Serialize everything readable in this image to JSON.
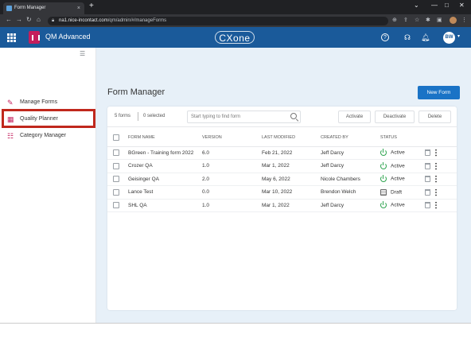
{
  "browser": {
    "tab_title": "Form Manager",
    "tab_close": "×",
    "new_tab": "+",
    "url_domain": "na1.nice-incontact.com",
    "url_path": "/qm/admin/#/manageForms",
    "window_controls": [
      "⌄",
      "—",
      "□",
      "✕"
    ]
  },
  "app": {
    "title": "QM Advanced",
    "logo_text": "CXone",
    "avatar_initials": "BW"
  },
  "sidebar": {
    "items": [
      {
        "label": "Manage Forms",
        "icon": "edit-form-icon"
      },
      {
        "label": "Quality Planner",
        "icon": "calendar-icon"
      },
      {
        "label": "Category Manager",
        "icon": "list-icon"
      }
    ]
  },
  "page": {
    "title": "Form Manager",
    "new_form_label": "New Form"
  },
  "toolbar": {
    "forms_count": "5 forms",
    "selected_count": "0 selected",
    "search_placeholder": "Start typing to find form",
    "activate_label": "Activate",
    "deactivate_label": "Deactivate",
    "delete_label": "Delete"
  },
  "table": {
    "headers": [
      "FORM NAME",
      "VERSION",
      "LAST MODIFIED",
      "CREATED BY",
      "STATUS"
    ],
    "rows": [
      {
        "name": "BGreen - Training form 2022",
        "version": "6.0",
        "modified": "Feb 21, 2022",
        "created_by": "Jeff Darcy",
        "status": "Active"
      },
      {
        "name": "Crozer QA",
        "version": "1.0",
        "modified": "Mar 1, 2022",
        "created_by": "Jeff Darcy",
        "status": "Active"
      },
      {
        "name": "Geisinger QA",
        "version": "2.0",
        "modified": "May 6, 2022",
        "created_by": "Nicole Chambers",
        "status": "Active"
      },
      {
        "name": "Lance Test",
        "version": "0.0",
        "modified": "Mar 10, 2022",
        "created_by": "Brendon Welch",
        "status": "Draft"
      },
      {
        "name": "SHL QA",
        "version": "1.0",
        "modified": "Mar 1, 2022",
        "created_by": "Jeff Darcy",
        "status": "Active"
      }
    ]
  },
  "colors": {
    "header_bg": "#1a5a9a",
    "accent": "#1a73c6",
    "active": "#2ea44f",
    "highlight": "#c0281d",
    "brand_pink": "#c41e5c"
  }
}
